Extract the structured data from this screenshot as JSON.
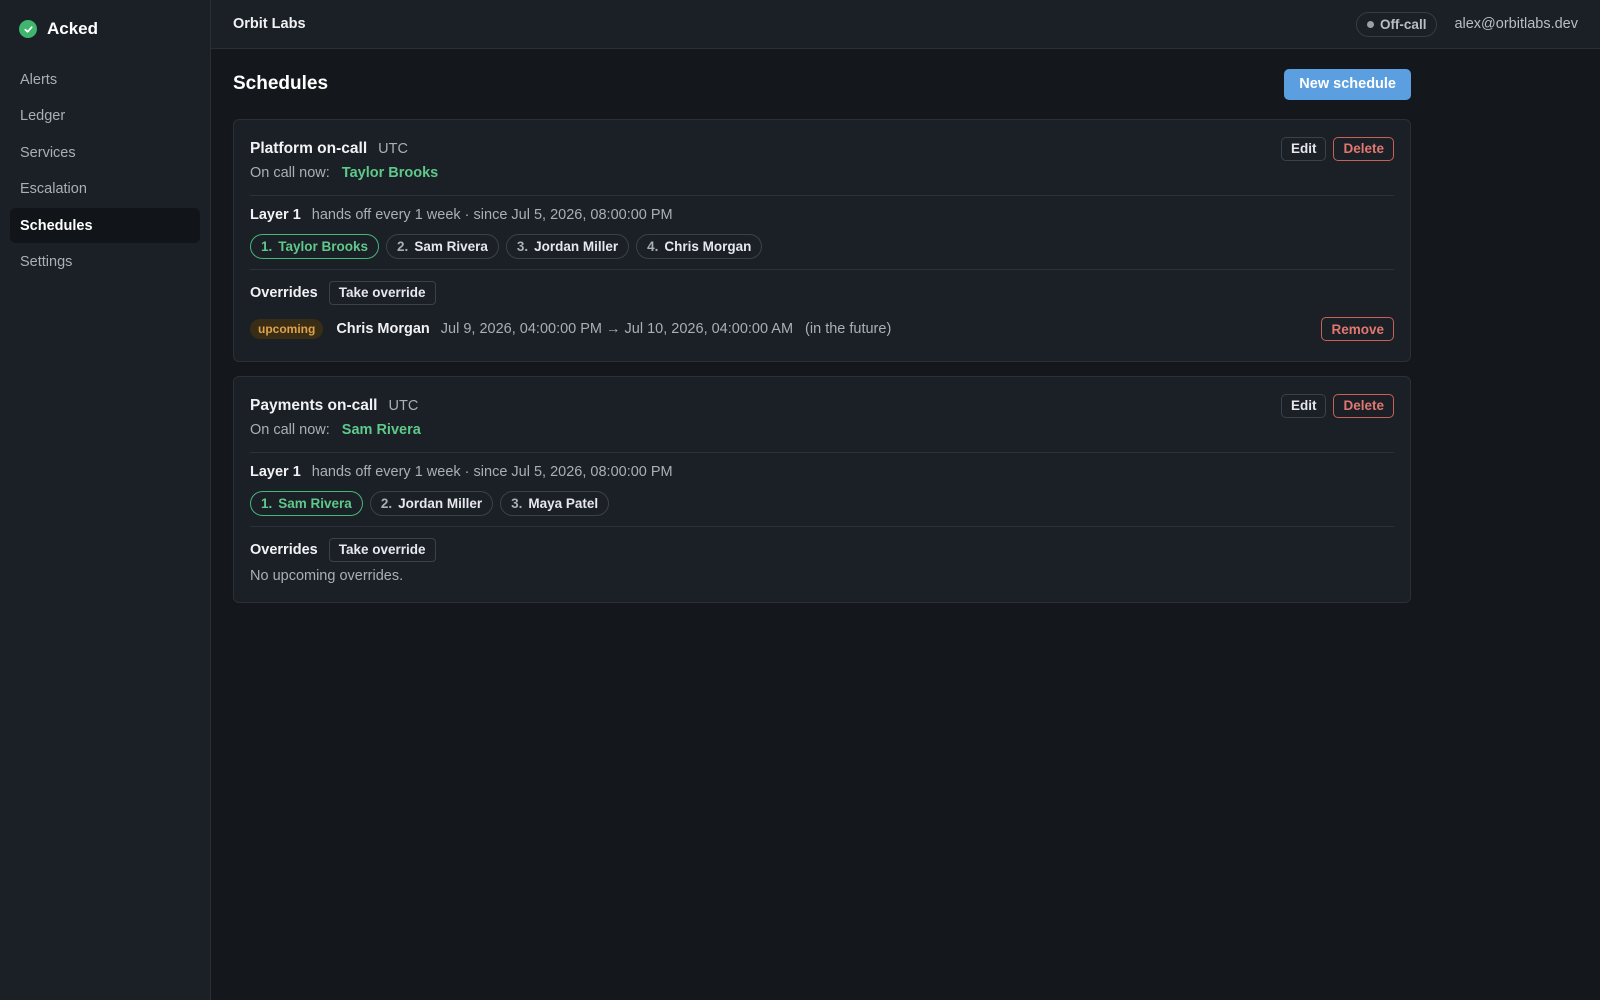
{
  "app": {
    "name": "Acked",
    "org": "Orbit Labs",
    "status": "Off-call",
    "user_email": "alex@orbitlabs.dev"
  },
  "icons": {
    "brand": "check-circle-icon",
    "status_dot": "dot-icon"
  },
  "colors": {
    "accent": "#5c9fe0",
    "on_call_green": "#5ec98a",
    "danger": "#e07870",
    "upcoming": "#e0a24a"
  },
  "sidebar": {
    "items": [
      {
        "label": "Alerts",
        "active": false
      },
      {
        "label": "Ledger",
        "active": false
      },
      {
        "label": "Services",
        "active": false
      },
      {
        "label": "Escalation",
        "active": false
      },
      {
        "label": "Schedules",
        "active": true
      },
      {
        "label": "Settings",
        "active": false
      }
    ]
  },
  "page": {
    "title": "Schedules",
    "new_button": "New schedule"
  },
  "schedules": [
    {
      "name": "Platform on-call",
      "tz": "UTC",
      "edit_label": "Edit",
      "delete_label": "Delete",
      "on_call_label": "On call now:",
      "on_call_name": "Taylor Brooks",
      "layer": {
        "label": "Layer 1",
        "desc": "hands off every 1 week · since Jul 5, 2026, 08:00:00 PM",
        "members": [
          {
            "num": "1.",
            "name": "Taylor Brooks",
            "current": true
          },
          {
            "num": "2.",
            "name": "Sam Rivera",
            "current": false
          },
          {
            "num": "3.",
            "name": "Jordan Miller",
            "current": false
          },
          {
            "num": "4.",
            "name": "Chris Morgan",
            "current": false
          }
        ]
      },
      "overrides_label": "Overrides",
      "take_override_label": "Take override",
      "overrides": [
        {
          "badge": "upcoming",
          "person": "Chris Morgan",
          "range": "Jul 9, 2026, 04:00:00 PM → Jul 10, 2026, 04:00:00 AM",
          "relative": "(in the future)",
          "remove_label": "Remove"
        }
      ],
      "no_overrides": ""
    },
    {
      "name": "Payments on-call",
      "tz": "UTC",
      "edit_label": "Edit",
      "delete_label": "Delete",
      "on_call_label": "On call now:",
      "on_call_name": "Sam Rivera",
      "layer": {
        "label": "Layer 1",
        "desc": "hands off every 1 week · since Jul 5, 2026, 08:00:00 PM",
        "members": [
          {
            "num": "1.",
            "name": "Sam Rivera",
            "current": true
          },
          {
            "num": "2.",
            "name": "Jordan Miller",
            "current": false
          },
          {
            "num": "3.",
            "name": "Maya Patel",
            "current": false
          }
        ]
      },
      "overrides_label": "Overrides",
      "take_override_label": "Take override",
      "overrides": [],
      "no_overrides": "No upcoming overrides."
    }
  ]
}
